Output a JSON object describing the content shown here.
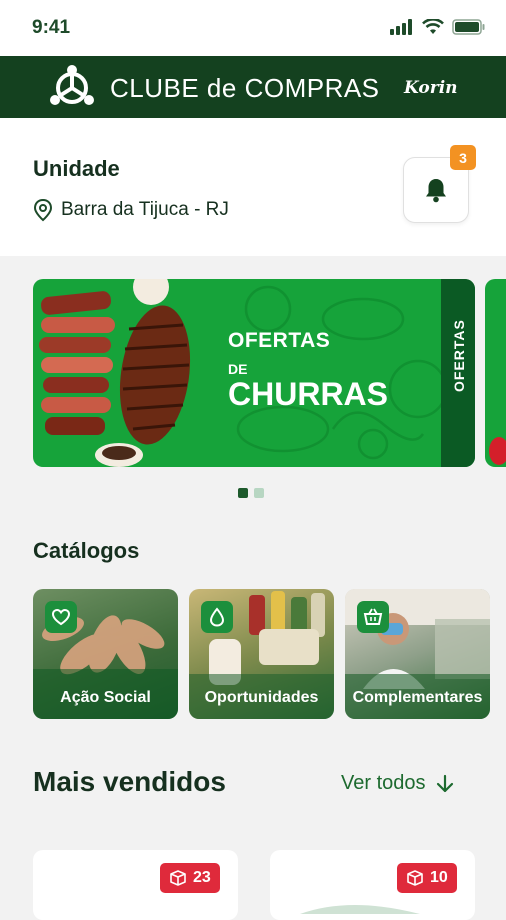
{
  "status_bar": {
    "time": "9:41"
  },
  "header": {
    "title": "CLUBE de COMPRAS",
    "brand": "Korin"
  },
  "unit": {
    "title": "Unidade",
    "location": "Barra da Tijuca - RJ",
    "notification_count": "3"
  },
  "banner": {
    "line1": "OFERTAS",
    "line2": "DE",
    "line3": "CHURRAS",
    "side_label": "OFERTAS",
    "page_count": 2,
    "active_page": 1
  },
  "catalogs": {
    "title": "Catálogos",
    "items": [
      {
        "label": "Ação Social",
        "icon": "heart-hand-icon"
      },
      {
        "label": "Oportunidades",
        "icon": "droplet-icon"
      },
      {
        "label": "Complementares",
        "icon": "basket-icon"
      }
    ]
  },
  "bestsellers": {
    "title": "Mais vendidos",
    "view_all": "Ver todos",
    "products": [
      {
        "count": "23",
        "icon": "box-icon"
      },
      {
        "count": "10",
        "icon": "box-icon"
      }
    ]
  },
  "colors": {
    "header_bg": "#14411f",
    "banner_green": "#16a33a",
    "accent_green": "#1d6a2f",
    "badge_orange": "#f39222",
    "product_badge_red": "#df2a3b"
  }
}
